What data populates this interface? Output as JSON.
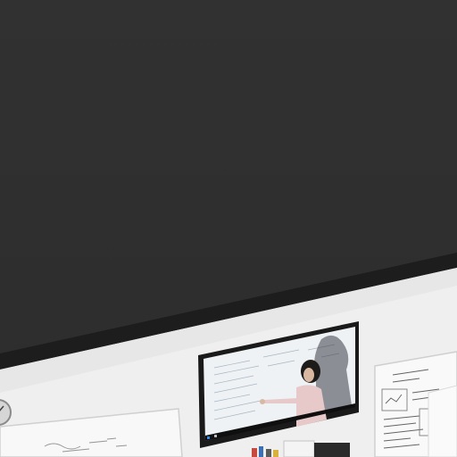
{
  "scene": {
    "description_label": "",
    "colors": {
      "ceiling": "#2e2e2e",
      "ceiling_trim": "#1f1f1f",
      "wall": "#f1f1f1",
      "wall_shadow": "#dcdcdc",
      "tv_bezel": "#1b1b1b",
      "tv_screen": "#e9eef2",
      "taskbar": "#111111",
      "whiteboard": "#f7f7f7",
      "whiteboard_frame": "#cfcfcf",
      "ink": "#3b3b3b"
    },
    "icons": [
      "clock-icon",
      "taskbar-start-icon",
      "taskbar-search-icon"
    ]
  }
}
